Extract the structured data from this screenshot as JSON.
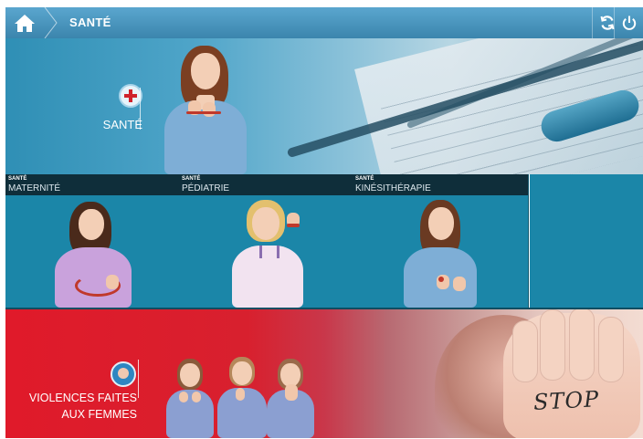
{
  "header": {
    "home_icon": "home-icon",
    "title": "SANTÉ",
    "refresh_icon": "refresh-icon",
    "power_icon": "power-icon"
  },
  "hero": {
    "category_icon": "medical-cross-icon",
    "label": "SANTÉ"
  },
  "tiles": [
    {
      "category": "SANTÉ",
      "name": "MATERNITÉ"
    },
    {
      "category": "SANTÉ",
      "name": "PÉDIATRIE"
    },
    {
      "category": "SANTÉ",
      "name": "KINÉSITHÉRAPIE"
    }
  ],
  "banner": {
    "icon": "woman-avatar-icon",
    "label_line1": "VIOLENCES FAITES",
    "label_line2": "AUX FEMMES",
    "photo_text": "STOP"
  },
  "colors": {
    "topbar": "#3b85ad",
    "tile_bg": "#1b86a8",
    "tile_header": "#0f2e3a",
    "banner_red": "#e01a2a"
  }
}
